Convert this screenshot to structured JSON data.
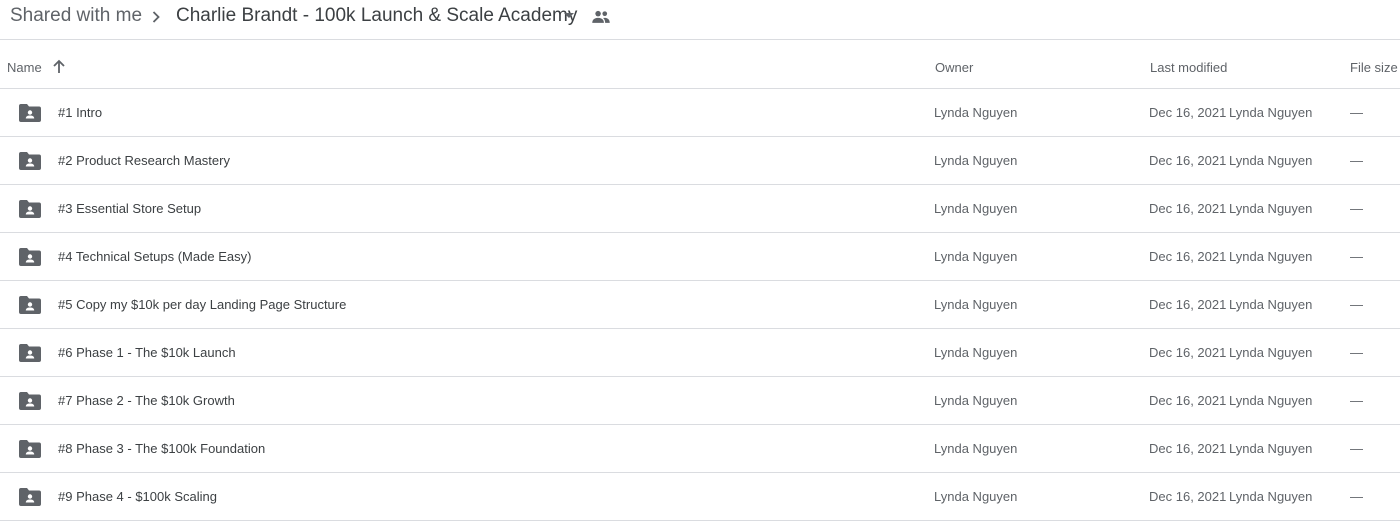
{
  "breadcrumb": {
    "root": "Shared with me",
    "current": "Charlie Brandt - 100k Launch & Scale Academy",
    "separator_icon": "chevron-right-icon",
    "dropdown_icon": "caret-down-icon",
    "shared_icon": "people-icon"
  },
  "columns": {
    "name": "Name",
    "owner": "Owner",
    "last_modified": "Last modified",
    "file_size": "File size",
    "sort_icon": "arrow-up-icon"
  },
  "rows": [
    {
      "name": "#1 Intro",
      "owner": "Lynda Nguyen",
      "modified_date": "Dec 16, 2021",
      "modified_by": "Lynda Nguyen",
      "size": "—"
    },
    {
      "name": "#2 Product Research Mastery",
      "owner": "Lynda Nguyen",
      "modified_date": "Dec 16, 2021",
      "modified_by": "Lynda Nguyen",
      "size": "—"
    },
    {
      "name": "#3 Essential Store Setup",
      "owner": "Lynda Nguyen",
      "modified_date": "Dec 16, 2021",
      "modified_by": "Lynda Nguyen",
      "size": "—"
    },
    {
      "name": "#4 Technical Setups (Made Easy)",
      "owner": "Lynda Nguyen",
      "modified_date": "Dec 16, 2021",
      "modified_by": "Lynda Nguyen",
      "size": "—"
    },
    {
      "name": "#5 Copy my $10k per day Landing Page Structure",
      "owner": "Lynda Nguyen",
      "modified_date": "Dec 16, 2021",
      "modified_by": "Lynda Nguyen",
      "size": "—"
    },
    {
      "name": "#6 Phase 1 - The $10k Launch",
      "owner": "Lynda Nguyen",
      "modified_date": "Dec 16, 2021",
      "modified_by": "Lynda Nguyen",
      "size": "—"
    },
    {
      "name": "#7 Phase 2 - The $10k Growth",
      "owner": "Lynda Nguyen",
      "modified_date": "Dec 16, 2021",
      "modified_by": "Lynda Nguyen",
      "size": "—"
    },
    {
      "name": "#8 Phase 3 - The $100k Foundation",
      "owner": "Lynda Nguyen",
      "modified_date": "Dec 16, 2021",
      "modified_by": "Lynda Nguyen",
      "size": "—"
    },
    {
      "name": "#9 Phase 4 - $100k Scaling",
      "owner": "Lynda Nguyen",
      "modified_date": "Dec 16, 2021",
      "modified_by": "Lynda Nguyen",
      "size": "—"
    }
  ],
  "row_icon": "shared-folder-icon",
  "colors": {
    "icon": "#5f6368",
    "text_primary": "#3c4043",
    "text_secondary": "#5f6368",
    "divider": "#dadce0"
  }
}
